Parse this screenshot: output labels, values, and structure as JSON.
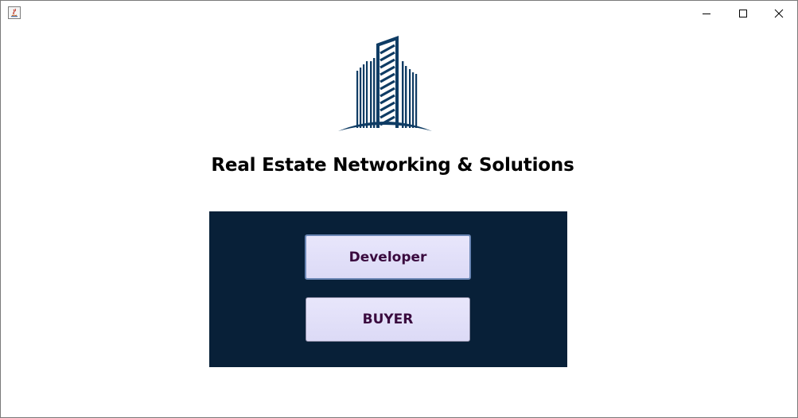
{
  "window": {
    "title": "",
    "controls": {
      "minimize": "minimize",
      "maximize": "maximize",
      "close": "close"
    }
  },
  "app": {
    "title": "Real Estate Networking & Solutions",
    "logo_icon": "buildings-logo-icon"
  },
  "panel": {
    "background": "#082038",
    "buttons": {
      "developer": "Developer",
      "buyer": "BUYER"
    }
  },
  "colors": {
    "logo_blue": "#0f3c64",
    "button_text": "#3a0b3f",
    "button_fill": "#e2e0f8"
  }
}
